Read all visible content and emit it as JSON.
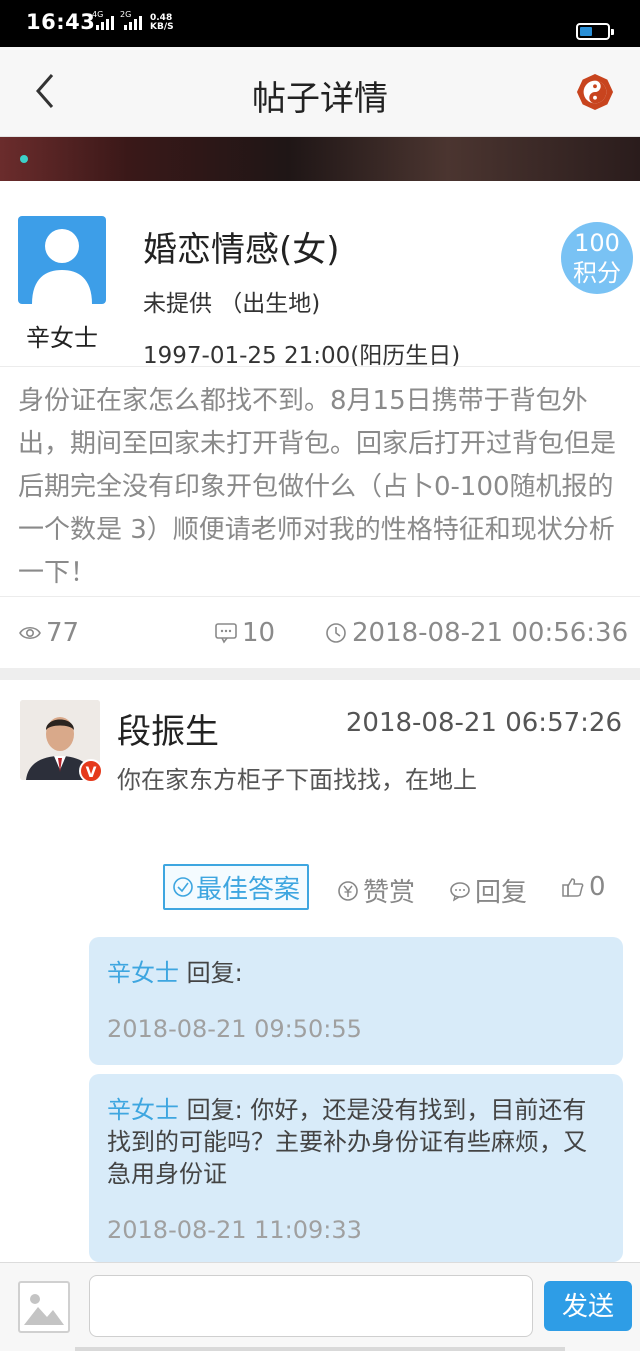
{
  "status_bar": {
    "time": "16:43",
    "signal1_label": "4G",
    "signal2_label": "2G",
    "net_speed_value": "0.48",
    "net_speed_unit": "KB/S",
    "battery_level": 0.45
  },
  "nav": {
    "title": "帖子详情",
    "back_icon": "chevron-left-icon",
    "right_icon": "yin-yang-icon"
  },
  "post": {
    "author": "辛女士",
    "category": "婚恋情感(女)",
    "birthplace": "未提供 （出生地)",
    "birthday": "1997-01-25 21:00(阳历生日)",
    "points_value": "100",
    "points_unit": "积分",
    "body": "身份证在家怎么都找不到。8月15日携带于背包外出，期间至回家未打开背包。回家后打开过背包但是后期完全没有印象开包做什么（占卜0-100随机报的一个数是 3）顺便请老师对我的性格特征和现状分析一下！",
    "views": "77",
    "comments": "10",
    "time": "2018-08-21 00:56:36"
  },
  "answer": {
    "name": "段振生",
    "time": "2018-08-21 06:57:26",
    "content": "你在家东方柜子下面找找，在地上",
    "badge": "V",
    "best_label": "最佳答案",
    "reward_label": "赞赏",
    "reply_label": "回复",
    "likes": "0"
  },
  "replies": [
    {
      "who": "辛女士",
      "prefix": " 回复:",
      "text": "",
      "time": "2018-08-21 09:50:55"
    },
    {
      "who": "辛女士",
      "prefix": " 回复:",
      "text": " 你好，还是没有找到，目前还有找到的可能吗？主要补办身份证有些麻烦，又急用身份证",
      "time": "2018-08-21 11:09:33"
    }
  ],
  "composer": {
    "placeholder": "",
    "send_label": "发送"
  },
  "colors": {
    "accent": "#3ea6e0",
    "reply_bg": "#d8ebf9",
    "send_bg": "#2e9de6",
    "points_bg": "#79c2f4"
  }
}
